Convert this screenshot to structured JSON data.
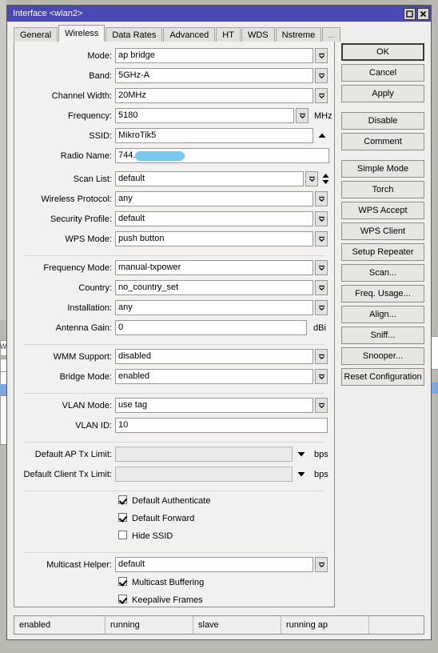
{
  "window": {
    "title": "Interface <wlan2>",
    "title_bar_color": "#4a48b5",
    "controls": {
      "maximize": "maximize-icon",
      "close": "close-icon"
    }
  },
  "tabs": [
    {
      "label": "General",
      "active": false
    },
    {
      "label": "Wireless",
      "active": true
    },
    {
      "label": "Data Rates",
      "active": false
    },
    {
      "label": "Advanced",
      "active": false
    },
    {
      "label": "HT",
      "active": false
    },
    {
      "label": "WDS",
      "active": false
    },
    {
      "label": "Nstreme",
      "active": false
    },
    {
      "label": "...",
      "active": false
    }
  ],
  "form": {
    "mode": {
      "label": "Mode:",
      "value": "ap bridge"
    },
    "band": {
      "label": "Band:",
      "value": "5GHz-A"
    },
    "channel_width": {
      "label": "Channel Width:",
      "value": "20MHz"
    },
    "frequency": {
      "label": "Frequency:",
      "value": "5180",
      "unit": "MHz"
    },
    "ssid": {
      "label": "SSID:",
      "value": "MikroTik5"
    },
    "radio_name": {
      "label": "Radio Name:",
      "value": "744."
    },
    "scan_list": {
      "label": "Scan List:",
      "value": "default"
    },
    "wireless_protocol": {
      "label": "Wireless Protocol:",
      "value": "any"
    },
    "security_profile": {
      "label": "Security Profile:",
      "value": "default"
    },
    "wps_mode": {
      "label": "WPS Mode:",
      "value": "push button"
    },
    "frequency_mode": {
      "label": "Frequency Mode:",
      "value": "manual-txpower"
    },
    "country": {
      "label": "Country:",
      "value": "no_country_set"
    },
    "installation": {
      "label": "Installation:",
      "value": "any"
    },
    "antenna_gain": {
      "label": "Antenna Gain:",
      "value": "0",
      "unit": "dBi"
    },
    "wmm_support": {
      "label": "WMM Support:",
      "value": "disabled"
    },
    "bridge_mode": {
      "label": "Bridge Mode:",
      "value": "enabled"
    },
    "vlan_mode": {
      "label": "VLAN Mode:",
      "value": "use tag"
    },
    "vlan_id": {
      "label": "VLAN ID:",
      "value": "10"
    },
    "default_ap_tx_limit": {
      "label": "Default AP Tx Limit:",
      "value": "",
      "unit": "bps"
    },
    "default_client_tx_limit": {
      "label": "Default Client Tx Limit:",
      "value": "",
      "unit": "bps"
    },
    "multicast_helper": {
      "label": "Multicast Helper:",
      "value": "default"
    }
  },
  "checkboxes": [
    {
      "label": "Default Authenticate",
      "checked": true
    },
    {
      "label": "Default Forward",
      "checked": true
    },
    {
      "label": "Hide SSID",
      "checked": false
    }
  ],
  "checkboxes_bottom": [
    {
      "label": "Multicast Buffering",
      "checked": true
    },
    {
      "label": "Keepalive Frames",
      "checked": true
    }
  ],
  "buttons": [
    {
      "label": "OK",
      "focused": true
    },
    {
      "label": "Cancel",
      "focused": false
    },
    {
      "label": "Apply",
      "focused": false
    },
    {
      "label": "Disable",
      "focused": false
    },
    {
      "label": "Comment",
      "focused": false
    },
    {
      "label": "Simple Mode",
      "focused": false
    },
    {
      "label": "Torch",
      "focused": false
    },
    {
      "label": "WPS Accept",
      "focused": false
    },
    {
      "label": "WPS Client",
      "focused": false
    },
    {
      "label": "Setup Repeater",
      "focused": false
    },
    {
      "label": "Scan...",
      "focused": false
    },
    {
      "label": "Freq. Usage...",
      "focused": false
    },
    {
      "label": "Align...",
      "focused": false
    },
    {
      "label": "Sniff...",
      "focused": false
    },
    {
      "label": "Snooper...",
      "focused": false
    },
    {
      "label": "Reset Configuration",
      "focused": false
    }
  ],
  "status_bar": [
    {
      "text": "enabled"
    },
    {
      "text": "running"
    },
    {
      "text": "slave"
    },
    {
      "text": "running ap"
    },
    {
      "text": ""
    }
  ],
  "background": {
    "label_wi": "Wi"
  }
}
